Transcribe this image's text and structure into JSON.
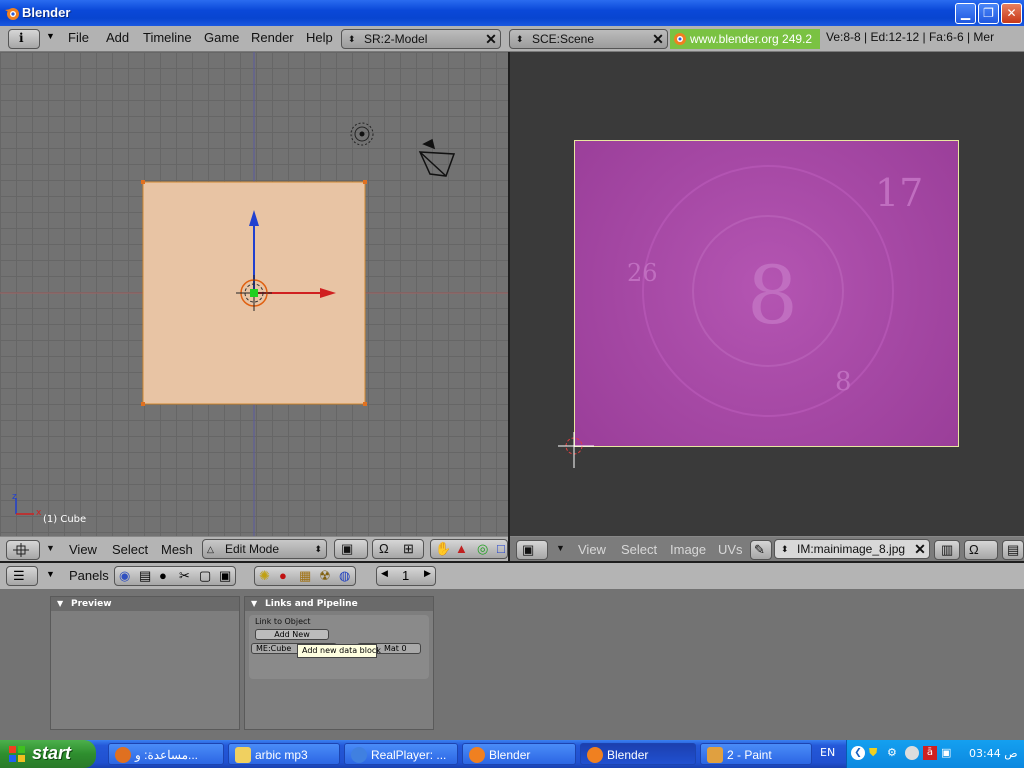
{
  "window": {
    "title": "Blender"
  },
  "top_header": {
    "menus": [
      "File",
      "Add",
      "Timeline",
      "Game",
      "Render",
      "Help"
    ],
    "screen_field": "SR:2-Model",
    "scene_field": "SCE:Scene",
    "url": "www.blender.org 249.2",
    "stats": "Ve:8-8 | Ed:12-12 | Fa:6-6 | Mer"
  },
  "view3d": {
    "object_label": "(1) Cube",
    "axis_x": "x",
    "axis_z": "z",
    "header": {
      "menus": [
        "View",
        "Select",
        "Mesh"
      ],
      "mode": "Edit Mode"
    }
  },
  "image_editor": {
    "header": {
      "menus": [
        "View",
        "Select",
        "Image",
        "UVs"
      ],
      "image_field": "IM:mainimage_8.jpg"
    },
    "image_numbers": {
      "big": "8",
      "n17": "17",
      "n26": "26",
      "n8": "8"
    }
  },
  "buttons_window": {
    "header": {
      "panels_label": "Panels",
      "page_number": "1"
    },
    "preview_panel": {
      "title": "Preview"
    },
    "links_panel": {
      "title": "Links and Pipeline",
      "link_to_object": "Link to Object",
      "add_new": "Add New",
      "mesh_field": "ME:Cube",
      "mat_field": "Mat 0",
      "tooltip": "Add new data block"
    }
  },
  "taskbar": {
    "start_label": "start",
    "tasks": [
      {
        "label": "مساعدة: و...",
        "active": false
      },
      {
        "label": "arbic mp3",
        "active": false
      },
      {
        "label": "RealPlayer: ...",
        "active": false
      },
      {
        "label": "Blender",
        "active": false
      },
      {
        "label": "Blender",
        "active": true
      },
      {
        "label": "2 - Paint",
        "active": false
      }
    ],
    "language": "EN",
    "clock": "03:44 ص"
  },
  "colors": {
    "cube_face": "#e8c4a4",
    "image_magenta": "#a94aa8",
    "xp_blue": "#245edc",
    "start_green": "#3a9a3a",
    "url_green": "#7ac242"
  }
}
